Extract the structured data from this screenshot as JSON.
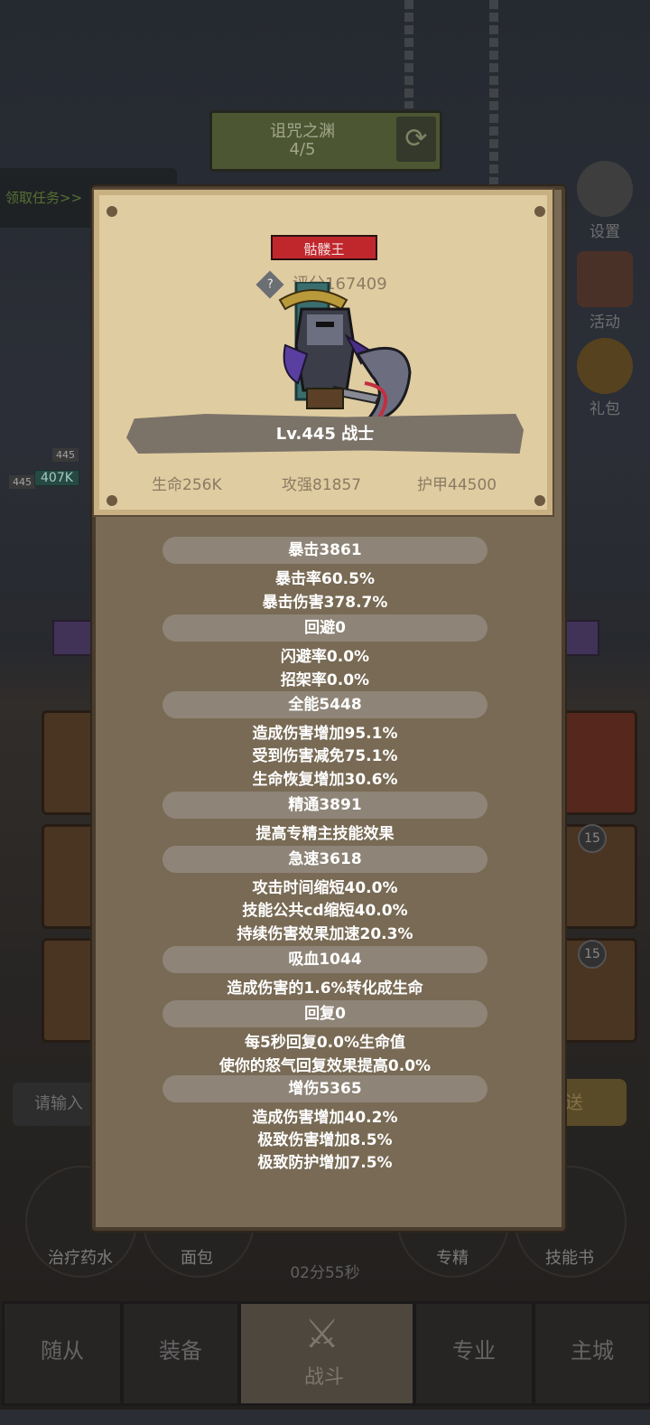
{
  "stage": {
    "name": "诅咒之渊",
    "progress": "4/5"
  },
  "task_tab": "领取任务>>",
  "side_buttons": [
    {
      "label": "设置",
      "icon": "gear-icon"
    },
    {
      "label": "活动",
      "icon": "calendar-icon"
    },
    {
      "label": "礼包",
      "icon": "gift-icon"
    }
  ],
  "party": {
    "level_a": "445",
    "level_b": "445",
    "hp": "407K"
  },
  "skill_badges": [
    "15",
    "15"
  ],
  "chat": {
    "placeholder": "请输入",
    "send": "发送"
  },
  "quick_items": [
    "治疗药水",
    "面包",
    "专精",
    "技能书"
  ],
  "timer": "02分55秒",
  "nav": [
    "随从",
    "装备",
    "战斗",
    "专业",
    "主城"
  ],
  "modal": {
    "boss_tag": "骷髅王",
    "score": "评分167409",
    "score_icon": "?",
    "level_class": "Lv.445 战士",
    "basic_stats": {
      "hp": "生命256K",
      "attack": "攻强81857",
      "armor": "护甲44500"
    },
    "sections": [
      {
        "title": "暴击3861",
        "lines": [
          "暴击率60.5%",
          "暴击伤害378.7%"
        ]
      },
      {
        "title": "回避0",
        "lines": [
          "闪避率0.0%",
          "招架率0.0%"
        ]
      },
      {
        "title": "全能5448",
        "lines": [
          "造成伤害增加95.1%",
          "受到伤害减免75.1%",
          "生命恢复增加30.6%"
        ]
      },
      {
        "title": "精通3891",
        "lines": [
          "提高专精主技能效果"
        ]
      },
      {
        "title": "急速3618",
        "lines": [
          "攻击时间缩短40.0%",
          "技能公共cd缩短40.0%",
          "持续伤害效果加速20.3%"
        ]
      },
      {
        "title": "吸血1044",
        "lines": [
          "造成伤害的1.6%转化成生命"
        ]
      },
      {
        "title": "回复0",
        "lines": [
          "每5秒回复0.0%生命值",
          "使你的怒气回复效果提高0.0%"
        ]
      },
      {
        "title": "增伤5365",
        "lines": [
          "造成伤害增加40.2%",
          "极致伤害增加8.5%",
          "极致防护增加7.5%"
        ]
      }
    ]
  },
  "colors": {
    "boss_tag": "#c0272d",
    "card": "#e0cca1",
    "panel": "#786a54",
    "section_bar": "#8e8477"
  }
}
